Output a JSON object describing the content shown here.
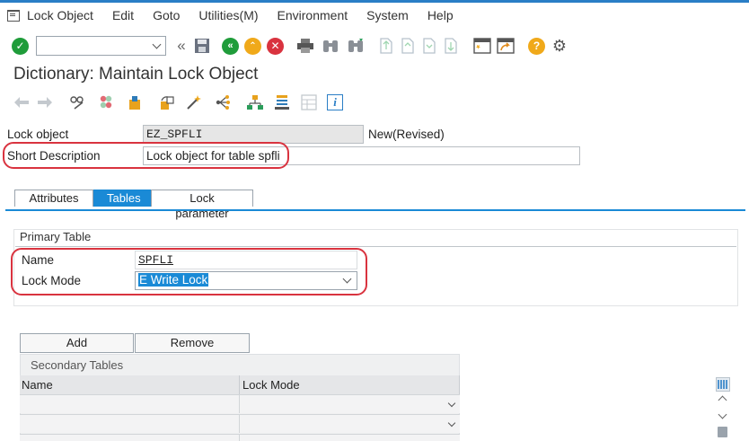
{
  "menubar": {
    "items": [
      "Lock Object",
      "Edit",
      "Goto",
      "Utilities(M)",
      "Environment",
      "System",
      "Help"
    ]
  },
  "toolbar": {
    "command_field_value": "",
    "icons": [
      "enter-check-icon",
      "command-field",
      "back-double-icon",
      "save-icon",
      "back-icon",
      "exit-icon",
      "cancel-icon",
      "print-icon",
      "find-icon",
      "find-next-icon",
      "first-page-icon",
      "previous-page-icon",
      "next-page-icon",
      "last-page-icon",
      "create-session-icon",
      "shortcut-icon",
      "help-icon",
      "customize-layout-icon"
    ],
    "colors": {
      "ok": "#1f9c3a",
      "back": "#1f9c3a",
      "exit": "#f0a91a",
      "cancel": "#d9333f",
      "help": "#f0a91a"
    }
  },
  "page": {
    "title": "Dictionary: Maintain Lock Object"
  },
  "app_toolbar": {
    "icons": [
      "back-arrow-icon",
      "forward-arrow-icon",
      "display-change-icon",
      "active-inactive-icon",
      "check-icon",
      "activate-icon",
      "where-used-icon",
      "object-list-icon",
      "hierarchy-icon",
      "navigation-window-icon",
      "table-icon",
      "info-icon"
    ]
  },
  "header": {
    "lock_object_label": "Lock object",
    "lock_object_value": "EZ_SPFLI",
    "status": "New(Revised)",
    "short_desc_label": "Short Description",
    "short_desc_value": "Lock object for table spfli"
  },
  "tabs": [
    {
      "label": "Attributes",
      "active": false
    },
    {
      "label": "Tables",
      "active": true
    },
    {
      "label": "Lock parameter",
      "active": false
    }
  ],
  "primary_table": {
    "title": "Primary Table",
    "name_label": "Name",
    "name_value": "SPFLI",
    "lock_mode_label": "Lock Mode",
    "lock_mode_value": "E Write Lock"
  },
  "secondary": {
    "add_label": "Add",
    "remove_label": "Remove",
    "title": "Secondary Tables",
    "columns": [
      "Name",
      "Lock Mode"
    ],
    "rows": [
      [
        "",
        ""
      ],
      [
        "",
        ""
      ],
      [
        "",
        ""
      ]
    ]
  },
  "accent": "#1a8ad6",
  "highlight_color": "#d9333f"
}
